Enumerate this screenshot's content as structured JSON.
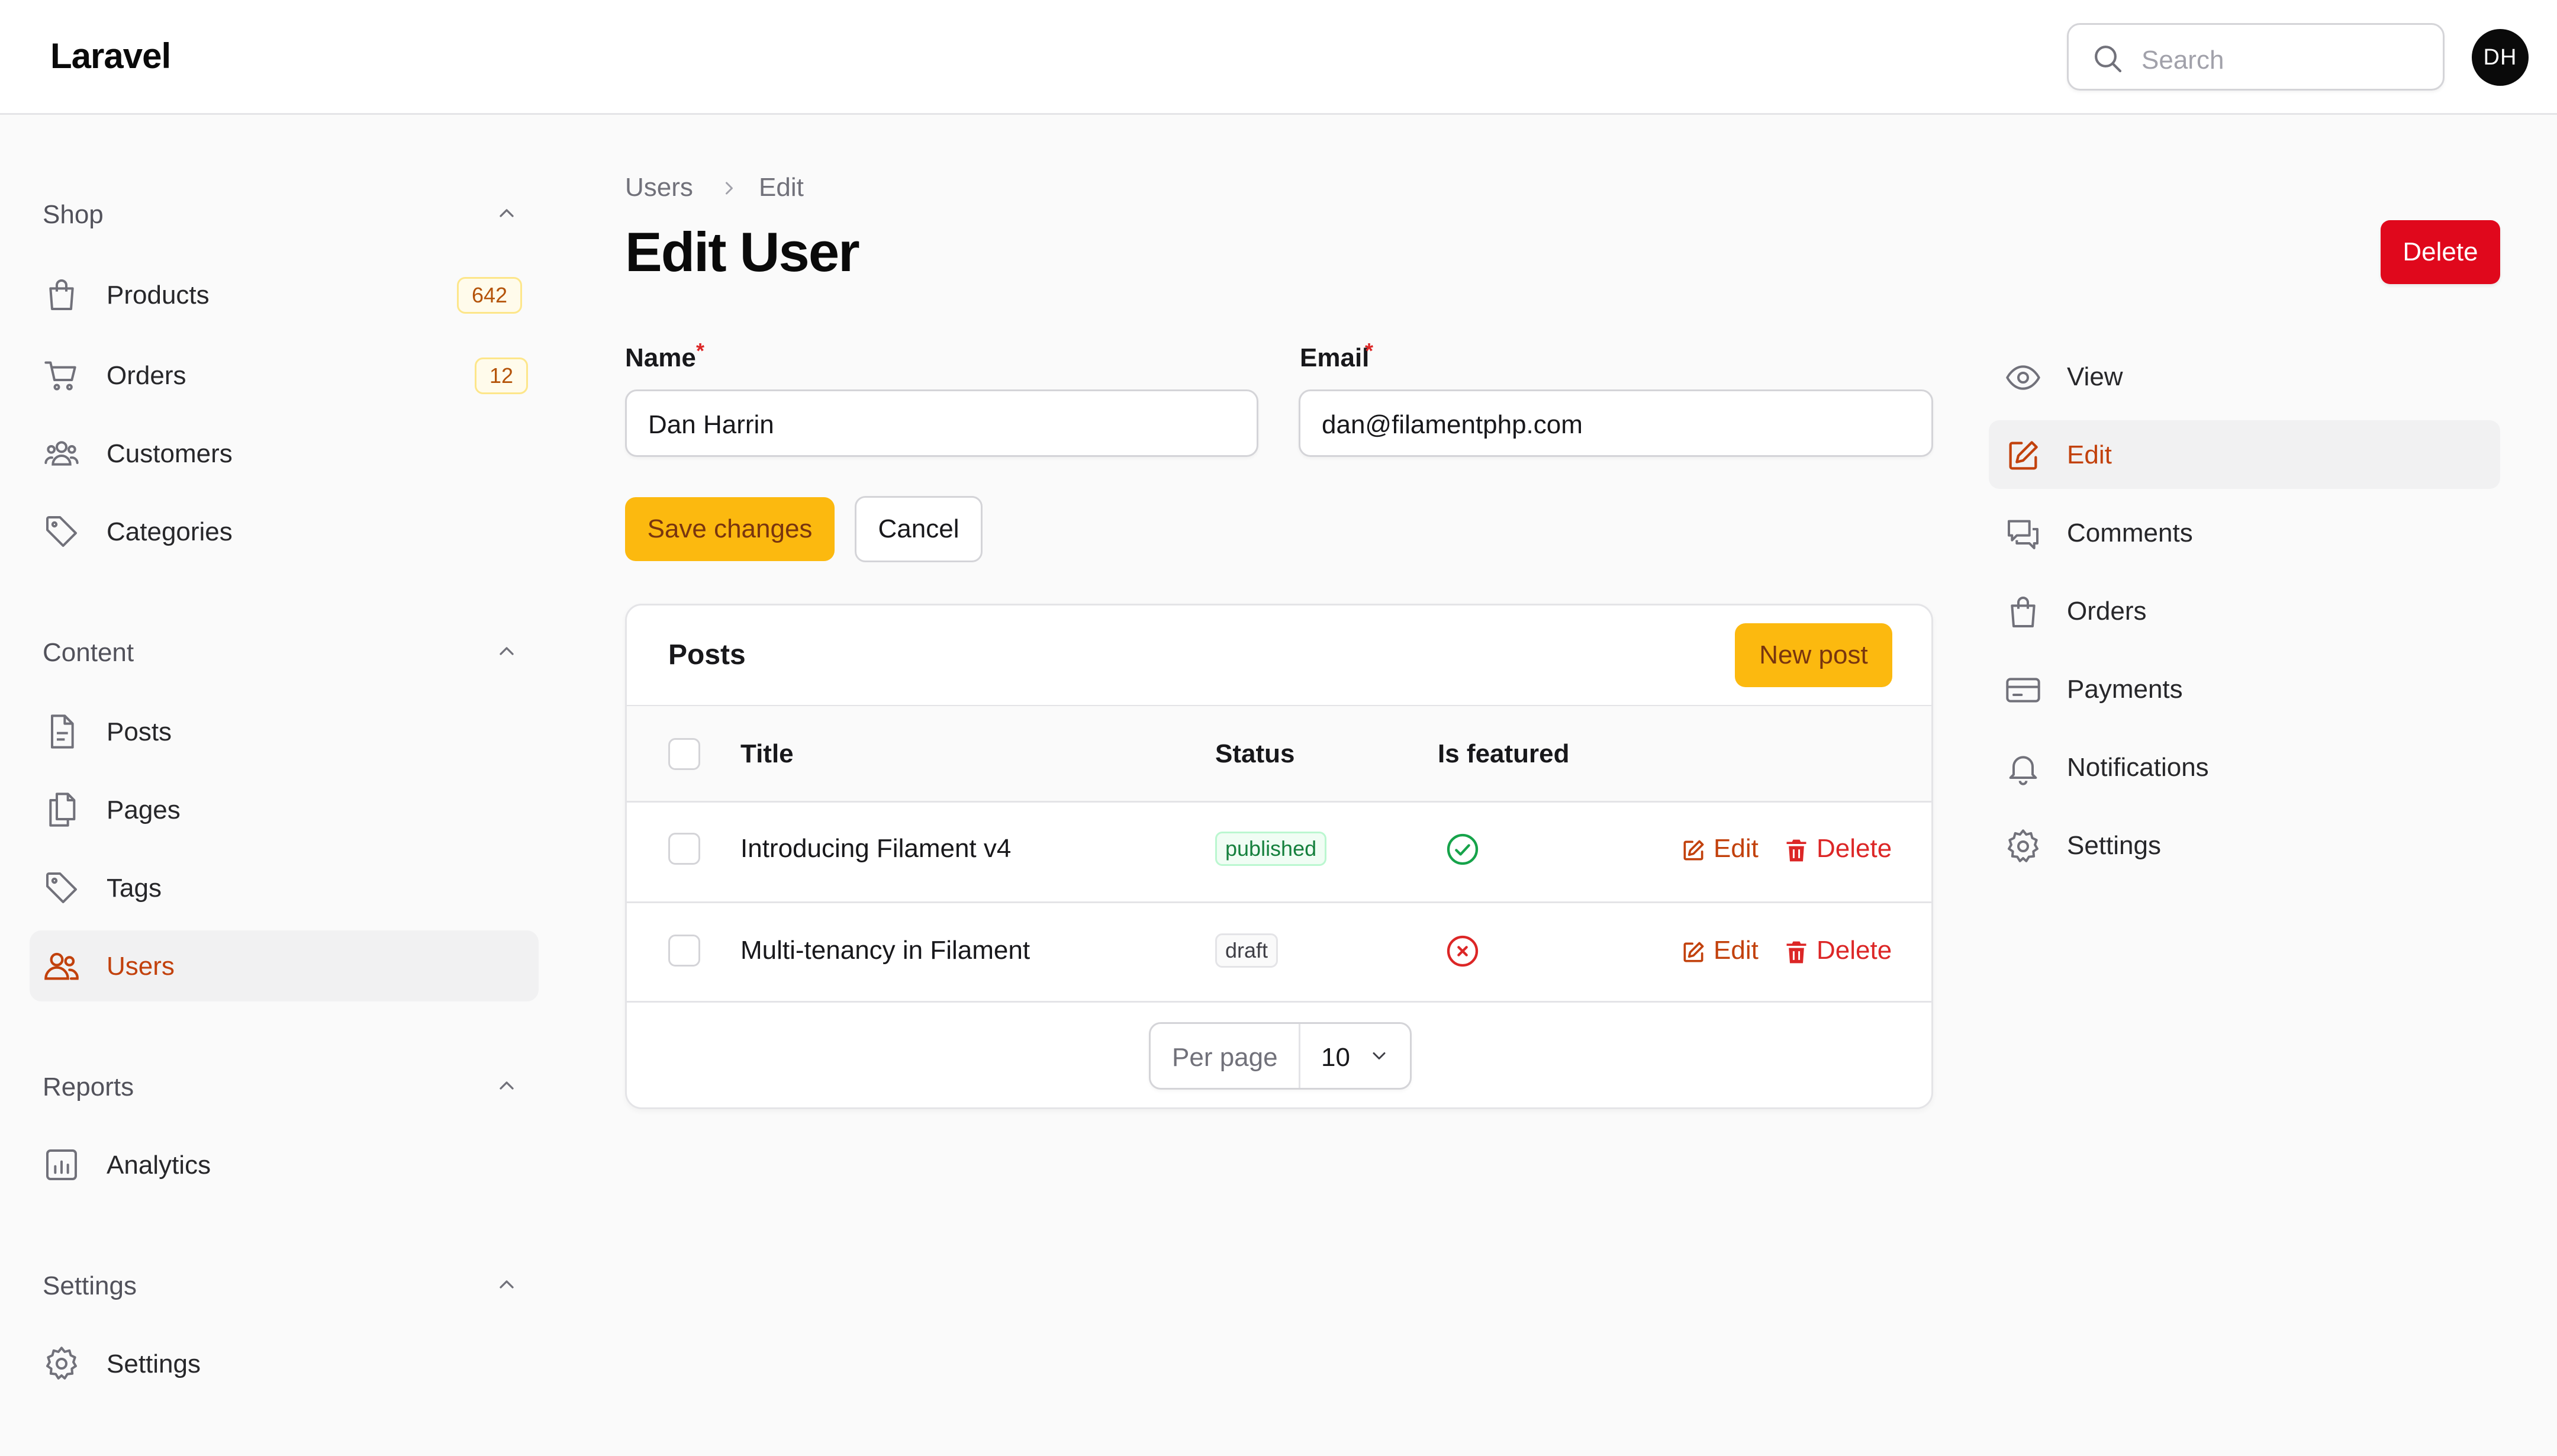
{
  "app": {
    "brand": "Laravel"
  },
  "header": {
    "search_placeholder": "Search",
    "avatar_initials": "DH"
  },
  "sidebar": {
    "groups": [
      {
        "label": "Shop",
        "items": [
          {
            "label": "Products",
            "badge": "642",
            "icon": "shopping-bag-icon"
          },
          {
            "label": "Orders",
            "badge": "12",
            "icon": "shopping-cart-icon"
          },
          {
            "label": "Customers",
            "icon": "user-group-icon"
          },
          {
            "label": "Categories",
            "icon": "tag-icon"
          }
        ]
      },
      {
        "label": "Content",
        "items": [
          {
            "label": "Posts",
            "icon": "document-icon"
          },
          {
            "label": "Pages",
            "icon": "documents-icon"
          },
          {
            "label": "Tags",
            "icon": "tag-icon"
          },
          {
            "label": "Users",
            "icon": "users-icon",
            "active": true
          }
        ]
      },
      {
        "label": "Reports",
        "items": [
          {
            "label": "Analytics",
            "icon": "chart-bar-icon"
          }
        ]
      },
      {
        "label": "Settings",
        "items": [
          {
            "label": "Settings",
            "icon": "cog-icon"
          }
        ]
      }
    ]
  },
  "main": {
    "breadcrumb": [
      "Users",
      "Edit"
    ],
    "title": "Edit User",
    "delete_label": "Delete",
    "form": {
      "name_label": "Name",
      "name_value": "Dan Harrin",
      "email_label": "Email",
      "email_value": "dan@filamentphp.com",
      "required_mark": "*",
      "save_label": "Save changes",
      "cancel_label": "Cancel"
    },
    "posts": {
      "title": "Posts",
      "new_label": "New post",
      "columns": [
        "Title",
        "Status",
        "Is featured"
      ],
      "rows": [
        {
          "title": "Introducing Filament v4",
          "status": "published",
          "featured": true,
          "edit": "Edit",
          "delete": "Delete"
        },
        {
          "title": "Multi-tenancy in Filament",
          "status": "draft",
          "featured": false,
          "edit": "Edit",
          "delete": "Delete"
        }
      ],
      "per_page_label": "Per page",
      "per_page_value": "10"
    }
  },
  "subnav": {
    "items": [
      {
        "label": "View",
        "icon": "eye-icon"
      },
      {
        "label": "Edit",
        "icon": "pencil-square-icon",
        "active": true
      },
      {
        "label": "Comments",
        "icon": "chat-bubbles-icon"
      },
      {
        "label": "Orders",
        "icon": "shopping-bag-icon"
      },
      {
        "label": "Payments",
        "icon": "credit-card-icon"
      },
      {
        "label": "Notifications",
        "icon": "bell-icon"
      },
      {
        "label": "Settings",
        "icon": "cog-icon"
      }
    ]
  },
  "colors": {
    "accent": "#c2410c",
    "primary_button": "#fcb90f",
    "danger": "#e0081c",
    "success": "#16a34a"
  }
}
